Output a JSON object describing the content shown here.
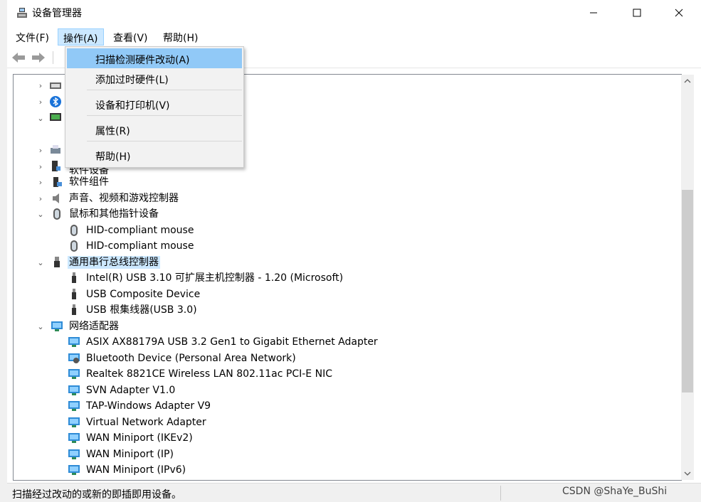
{
  "window": {
    "title": "设备管理器",
    "controls": {
      "minimize": "minimize",
      "maximize": "maximize",
      "close": "close"
    }
  },
  "menubar": {
    "items": [
      {
        "label": "文件(F)"
      },
      {
        "label": "操作(A)",
        "active": true
      },
      {
        "label": "查看(V)"
      },
      {
        "label": "帮助(H)"
      }
    ]
  },
  "action_menu": {
    "items": [
      {
        "label": "扫描检测硬件改动(A)",
        "highlighted": true
      },
      {
        "label": "添加过时硬件(L)"
      },
      {
        "label": "设备和打印机(V)"
      },
      {
        "label": "属性(R)"
      },
      {
        "label": "帮助(H)"
      }
    ]
  },
  "tree": {
    "partial_rows": [
      "软件设备"
    ],
    "rows": [
      {
        "label": "软件组件",
        "icon": "software-component-icon",
        "expander": "collapsed"
      },
      {
        "label": "声音、视频和游戏控制器",
        "icon": "speaker-icon",
        "expander": "collapsed"
      },
      {
        "label": "鼠标和其他指针设备",
        "icon": "mouse-icon",
        "expander": "expanded"
      },
      {
        "label": "HID-compliant mouse",
        "icon": "mouse-icon",
        "child": true
      },
      {
        "label": "HID-compliant mouse",
        "icon": "mouse-icon",
        "child": true
      },
      {
        "label": "通用串行总线控制器",
        "icon": "usb-icon",
        "expander": "expanded",
        "selected": true
      },
      {
        "label": "Intel(R) USB 3.10 可扩展主机控制器 - 1.20 (Microsoft)",
        "icon": "usb-icon",
        "child": true
      },
      {
        "label": "USB Composite Device",
        "icon": "usb-icon",
        "child": true
      },
      {
        "label": "USB 根集线器(USB 3.0)",
        "icon": "usb-icon",
        "child": true
      },
      {
        "label": "网络适配器",
        "icon": "network-icon",
        "expander": "expanded"
      },
      {
        "label": "ASIX AX88179A USB 3.2 Gen1 to Gigabit Ethernet Adapter",
        "icon": "network-icon",
        "child": true
      },
      {
        "label": "Bluetooth Device (Personal Area Network)",
        "icon": "network-icon",
        "child": true
      },
      {
        "label": "Realtek 8821CE Wireless LAN 802.11ac PCI-E NIC",
        "icon": "network-icon",
        "child": true
      },
      {
        "label": "SVN Adapter V1.0",
        "icon": "network-icon",
        "child": true
      },
      {
        "label": "TAP-Windows Adapter V9",
        "icon": "network-icon",
        "child": true
      },
      {
        "label": "Virtual Network Adapter",
        "icon": "network-icon",
        "child": true
      },
      {
        "label": "WAN Miniport (IKEv2)",
        "icon": "network-icon",
        "child": true
      },
      {
        "label": "WAN Miniport (IP)",
        "icon": "network-icon",
        "child": true
      },
      {
        "label": "WAN Miniport (IPv6)",
        "icon": "network-icon",
        "child": true
      }
    ]
  },
  "statusbar": {
    "text": "扫描经过改动的或新的即插即用设备。",
    "watermark": "CSDN @ShaYe_BuShi"
  },
  "colors": {
    "menu_active_bg": "#cce8ff",
    "dropdown_highlight": "#91c9f7",
    "selection_bg": "#cce8ff"
  }
}
